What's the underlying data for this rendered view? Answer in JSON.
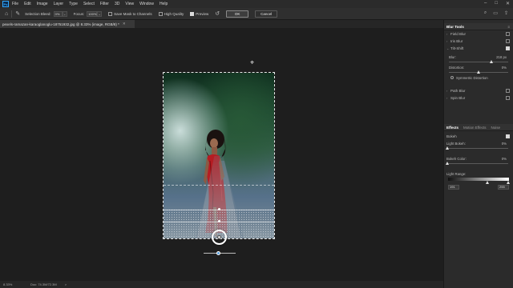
{
  "app": {
    "logo": "Ps"
  },
  "menu": {
    "items": [
      "File",
      "Edit",
      "Image",
      "Layer",
      "Type",
      "Select",
      "Filter",
      "3D",
      "View",
      "Window",
      "Help"
    ]
  },
  "options_bar": {
    "selection_bleed_label": "Selection Bleed:",
    "selection_bleed_value": "0%",
    "focus_label": "Focus:",
    "focus_value": "100%",
    "save_mask_label": "Save Mask to Channels",
    "high_quality_label": "High Quality",
    "preview_label": "Preview",
    "ok_label": "OK",
    "cancel_label": "Cancel"
  },
  "document_tab": {
    "title": "pexels-ramazan-karaoglanoglu-18751932.jpg @ 8.33% (image, RGB/8) *"
  },
  "status": {
    "zoom": "8.33%",
    "doc": "Doc: 74.3M/72.3M",
    "arrow": ">"
  },
  "blur_tools": {
    "title": "Blur Tools",
    "items": [
      {
        "label": "Field Blur",
        "checked": false
      },
      {
        "label": "Iris Blur",
        "checked": false
      },
      {
        "label": "Tilt-Shift",
        "checked": true
      },
      {
        "label": "Path Blur",
        "checked": false
      },
      {
        "label": "Spin Blur",
        "checked": false
      }
    ],
    "tilt_shift": {
      "blur_label": "Blur:",
      "blur_value": "218 px",
      "blur_position": 0.72,
      "distortion_label": "Distortion:",
      "distortion_value": "0%",
      "distortion_position": 0.5,
      "symmetric_label": "Symmetric Distortion"
    }
  },
  "effects": {
    "tabs": [
      "Effects",
      "Motion Effects",
      "Noise"
    ],
    "bokeh_label": "Bokeh",
    "bokeh_checked": true,
    "light_bokeh_label": "Light Bokeh:",
    "light_bokeh_value": "0%",
    "light_bokeh_position": 0.0,
    "bokeh_color_label": "Bokeh Color:",
    "bokeh_color_value": "0%",
    "bokeh_color_position": 0.0,
    "light_range_label": "Light Range:",
    "light_range_low": "191",
    "light_range_high": "255"
  }
}
